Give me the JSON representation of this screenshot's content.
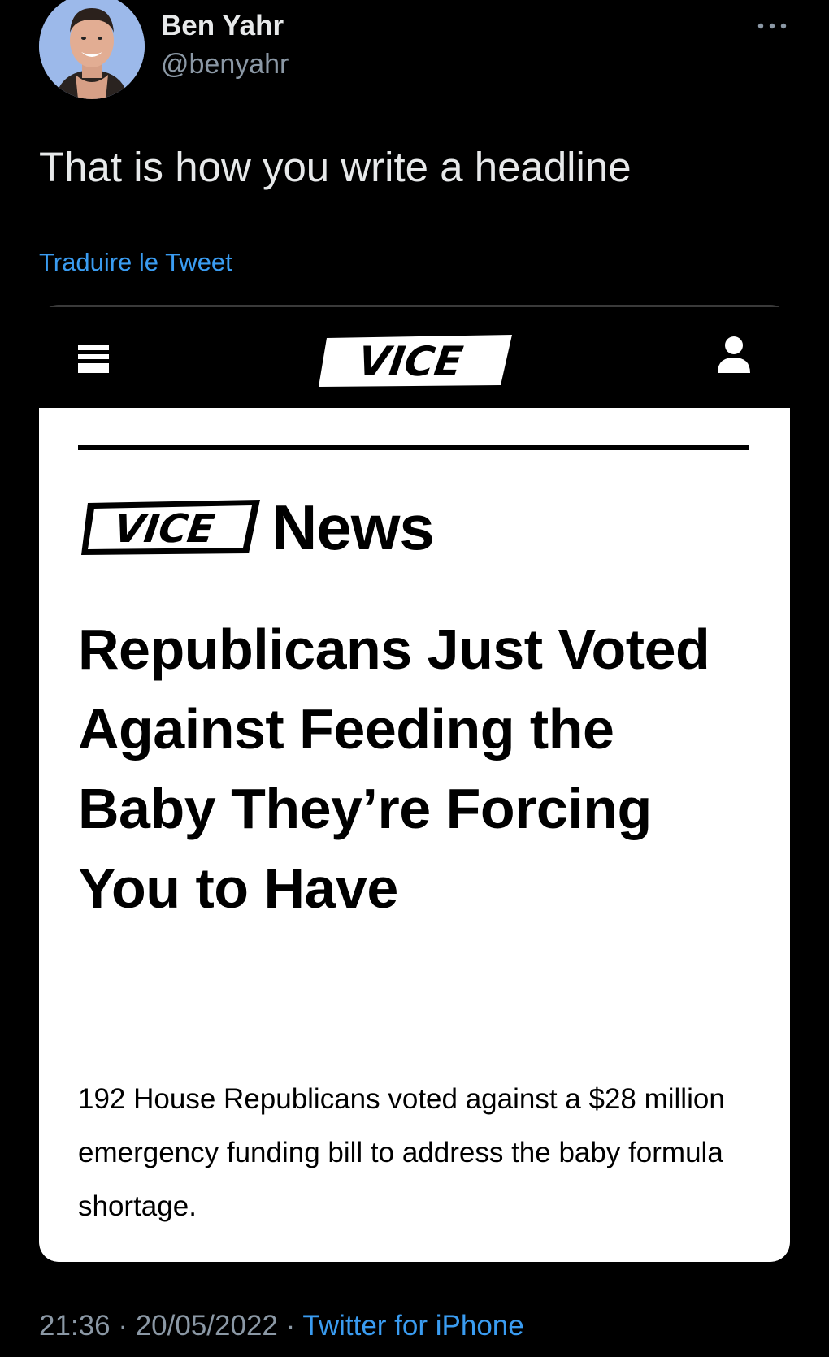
{
  "tweet": {
    "author": {
      "display_name": "Ben Yahr",
      "handle": "@benyahr"
    },
    "text": "That is how you write a headline",
    "translate_label": "Traduire le Tweet",
    "timestamp_time": "21:36",
    "separator": "·",
    "timestamp_date": "20/05/2022",
    "source": "Twitter for iPhone"
  },
  "embedded": {
    "site_logo": "VICE",
    "section_label": "News",
    "headline": "Republicans Just Voted Against Feeding the Baby They’re Forcing You to Have",
    "dek": "192 House Republicans voted against a $28 million emergency funding bill to address the baby formula shortage."
  },
  "icons": {
    "more": "more-horizontal-icon",
    "menu": "hamburger-menu-icon",
    "account": "user-icon"
  },
  "colors": {
    "background": "#000000",
    "primary_text": "#e7e9ea",
    "secondary_text": "#8b98a5",
    "link": "#3a9cf1",
    "card": "#ffffff"
  }
}
